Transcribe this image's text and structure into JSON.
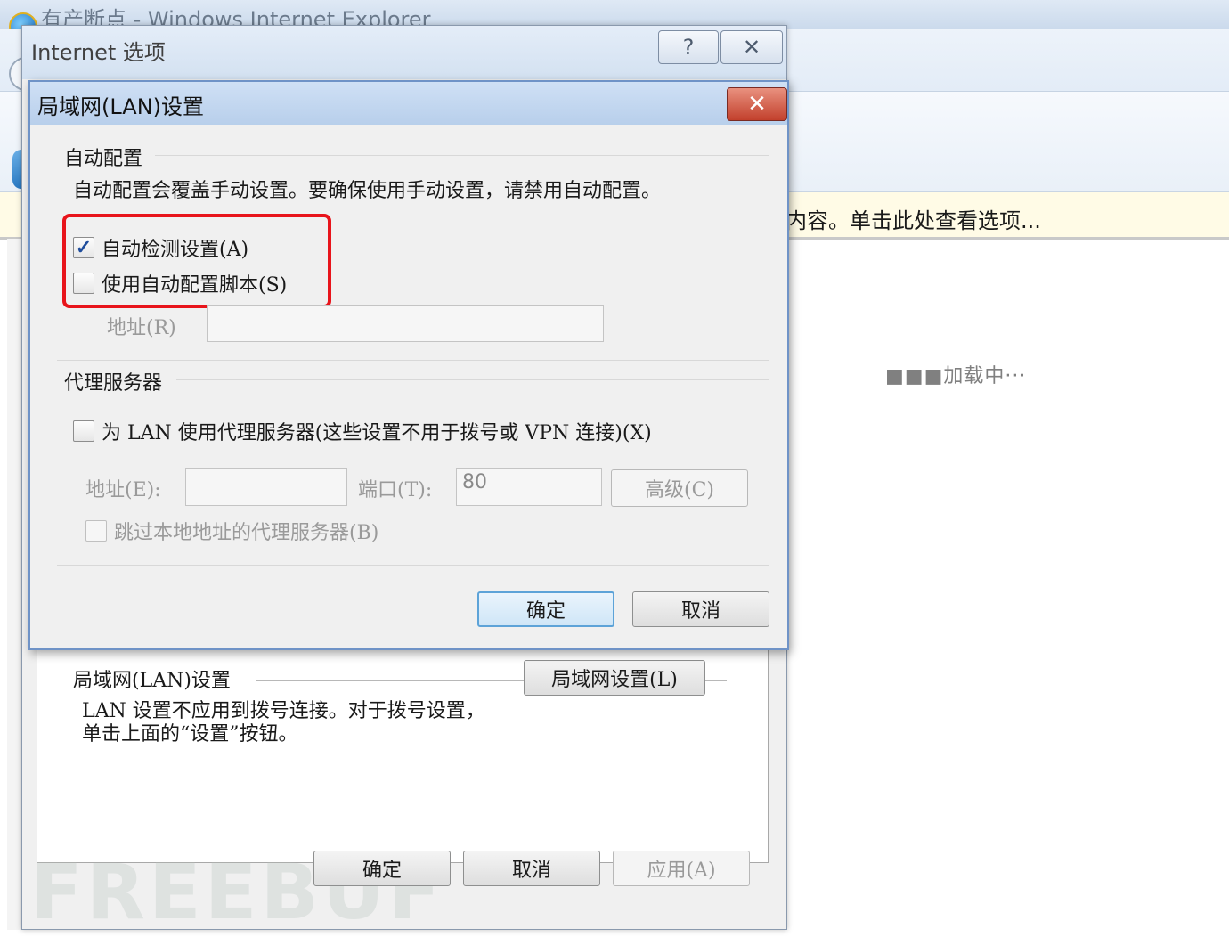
{
  "browser": {
    "title": "有产断点 - Windows Internet Explorer",
    "infobar_text": "内容。单击此处查看选项...",
    "loading_text": "■■■加载中···"
  },
  "internet_options": {
    "title": "Internet 选项",
    "help_label": "?",
    "close_label": "✕",
    "lan_section_title": "局域网(LAN)设置",
    "lan_section_desc": "LAN 设置不应用到拨号连接。对于拨号设置，单击上面的“设置”按钮。",
    "lan_settings_button": "局域网设置(L)",
    "ok_label": "确定",
    "cancel_label": "取消",
    "apply_label": "应用(A)"
  },
  "lan_dialog": {
    "title": "局域网(LAN)设置",
    "close_label": "✕",
    "auto_config": {
      "group_title": "自动配置",
      "description": "自动配置会覆盖手动设置。要确保使用手动设置，请禁用自动配置。",
      "auto_detect_label": "自动检测设置(A)",
      "auto_detect_checked": true,
      "script_label": "使用自动配置脚本(S)",
      "script_checked": false,
      "address_label": "地址(R)",
      "address_value": ""
    },
    "proxy": {
      "group_title": "代理服务器",
      "use_proxy_label": "为 LAN 使用代理服务器(这些设置不用于拨号或 VPN 连接)(X)",
      "use_proxy_checked": false,
      "address_label": "地址(E):",
      "address_value": "",
      "port_label": "端口(T):",
      "port_value": "80",
      "advanced_label": "高级(C)",
      "bypass_label": "跳过本地地址的代理服务器(B)",
      "bypass_checked": false
    },
    "ok_label": "确定",
    "cancel_label": "取消"
  },
  "watermark": "FREEBUF",
  "colors": {
    "highlight_box": "#e8141b",
    "close_button": "#c2402c",
    "checkmark": "#1f4d9c"
  }
}
